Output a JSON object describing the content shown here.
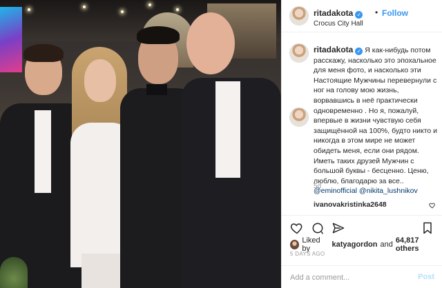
{
  "post": {
    "username": "ritadakota",
    "follow_label": "Follow",
    "separator": "•",
    "location": "Crocus City Hall",
    "caption_username": "ritadakota",
    "caption_lines": [
      "Я как-нибудь потом",
      "расскажу, насколько это эпохальное",
      "для меня фото, и насколько эти",
      "Настоящие Мужчины перевернули с",
      "ног на голову мою жизнь,",
      "ворвавшись в неё практически",
      "одновременно . Но я, пожалуй,",
      "впервые в жизни чувствую себя",
      "защищённой на 100%, будто никто и",
      "никогда в этом мире не может",
      "обидеть меня, если они рядом.",
      "Иметь таких друзей Мужчин с",
      "большой буквы - бесценно. Ценю,",
      "люблю, благодарю за все.."
    ],
    "mentions": [
      "@eminofficial",
      "@nikita_lushnikov"
    ],
    "caption_age": "5d",
    "comment_username": "ivanovakristinka2648",
    "liked_by_prefix": "Liked by",
    "liked_by_user": "katyagordon",
    "liked_by_and": "and",
    "likes_count": "64,817 others",
    "timestamp": "5 DAYS AGO",
    "comment_placeholder": "Add a comment...",
    "post_label": "Post"
  },
  "colors": {
    "accent": "#3897f0",
    "mention": "#003569",
    "muted": "#999999",
    "post_disabled": "#b2dffc",
    "border": "#efefef"
  },
  "icons": {
    "like": "heart-icon",
    "comment": "comment-icon",
    "share": "share-icon",
    "save": "bookmark-icon"
  }
}
